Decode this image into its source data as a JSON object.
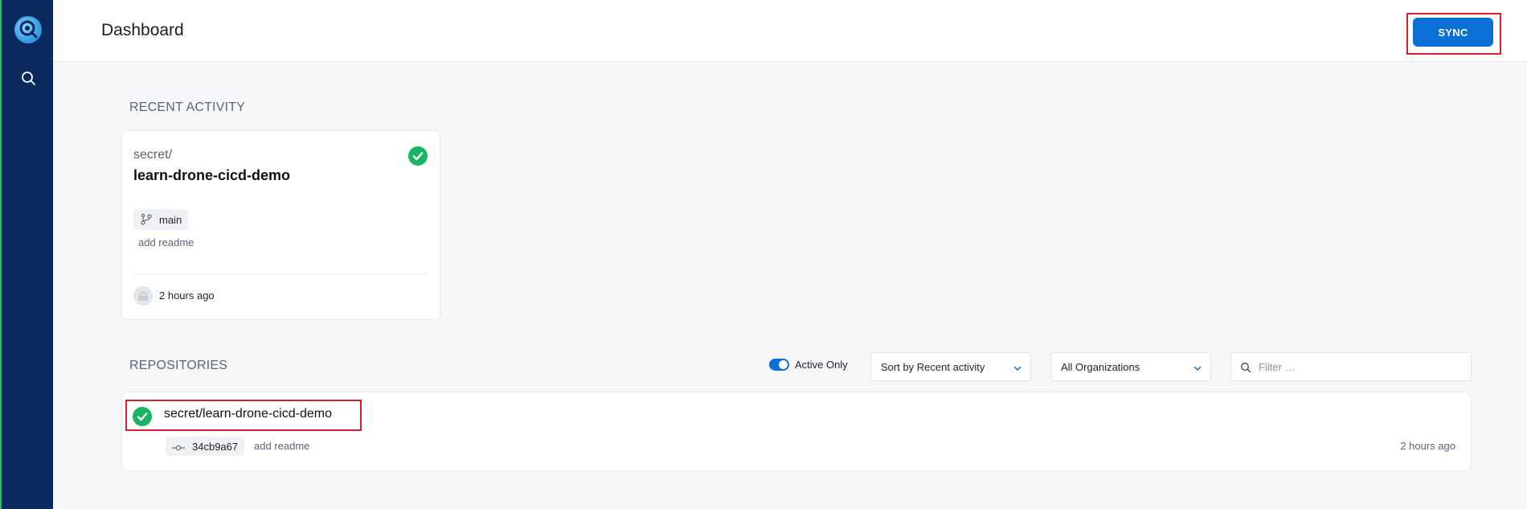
{
  "sidebar": {
    "logo_icon": "drone-logo-icon",
    "search_icon": "search-icon"
  },
  "header": {
    "title": "Dashboard",
    "sync_label": "SYNC"
  },
  "recent_activity": {
    "heading": "RECENT ACTIVITY",
    "card": {
      "namespace": "secret/",
      "name": "learn-drone-cicd-demo",
      "status": "success",
      "branch": "main",
      "message": "add readme",
      "time": "2 hours ago"
    }
  },
  "repositories": {
    "heading": "REPOSITORIES",
    "active_only_label": "Active Only",
    "active_only": true,
    "sort_value": "Sort by Recent activity",
    "org_value": "All Organizations",
    "filter_placeholder": "Filter …",
    "rows": [
      {
        "name": "secret/learn-drone-cicd-demo",
        "status": "success",
        "commit": "34cb9a67",
        "message": "add readme",
        "time": "2 hours ago"
      }
    ]
  },
  "colors": {
    "sidebar": "#0a2a5e",
    "accent": "#0a6fd6",
    "success": "#19b565",
    "highlight": "#d91f2a"
  }
}
